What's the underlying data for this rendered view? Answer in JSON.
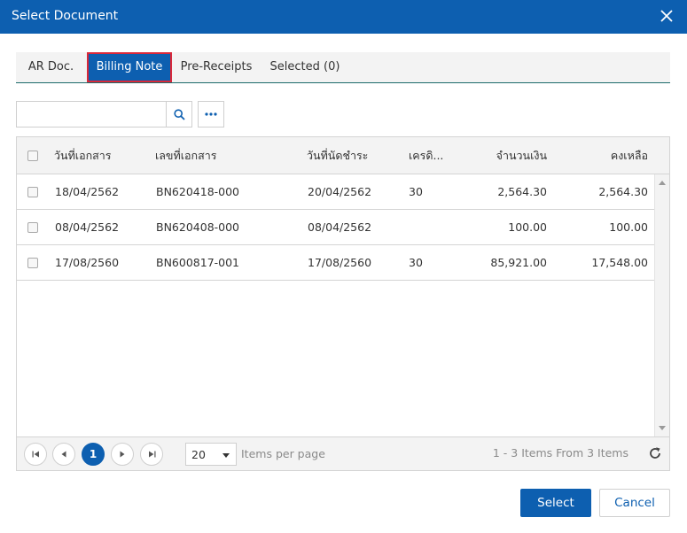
{
  "dialog": {
    "title": "Select Document"
  },
  "tabs": [
    {
      "label": "AR Doc."
    },
    {
      "label": "Billing Note"
    },
    {
      "label": "Pre-Receipts"
    },
    {
      "label": "Selected (0)"
    }
  ],
  "search": {
    "value": "",
    "placeholder": ""
  },
  "grid": {
    "columns": [
      "วันที่เอกสาร",
      "เลขที่เอกสาร",
      "วันที่นัดชำระ",
      "เครดิ...",
      "จำนวนเงิน",
      "คงเหลือ"
    ],
    "rows": [
      {
        "doc_date": "18/04/2562",
        "doc_no": "BN620418-000",
        "due_date": "20/04/2562",
        "credit": "30",
        "amount": "2,564.30",
        "balance": "2,564.30"
      },
      {
        "doc_date": "08/04/2562",
        "doc_no": "BN620408-000",
        "due_date": "08/04/2562",
        "credit": "",
        "amount": "100.00",
        "balance": "100.00"
      },
      {
        "doc_date": "17/08/2560",
        "doc_no": "BN600817-001",
        "due_date": "17/08/2560",
        "credit": "30",
        "amount": "85,921.00",
        "balance": "17,548.00"
      }
    ]
  },
  "pager": {
    "current_page": "1",
    "page_size": "20",
    "items_per_page_label": "Items per page",
    "info": "1 - 3 Items From 3 Items"
  },
  "footer": {
    "select_label": "Select",
    "cancel_label": "Cancel"
  },
  "colors": {
    "primary": "#0d5fb0",
    "active_tab_border": "#d9283a",
    "tab_bar_bg": "#f3f3f3"
  }
}
